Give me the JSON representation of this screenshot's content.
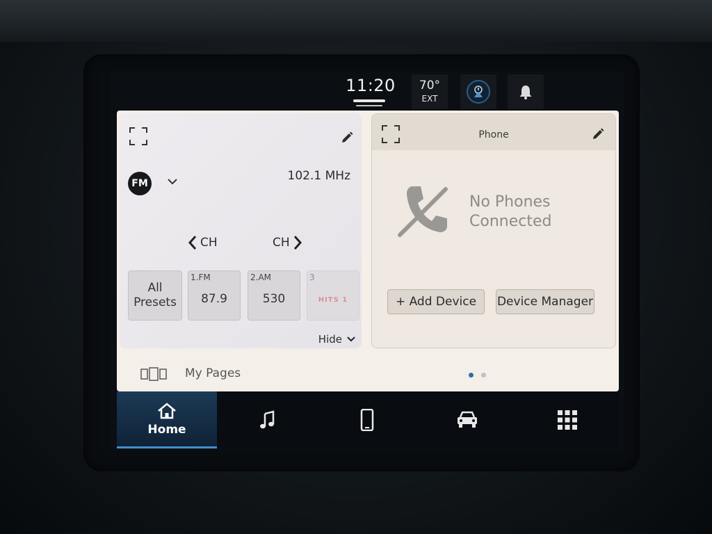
{
  "status_bar": {
    "time": "11:20",
    "temperature": "70°",
    "temperature_label": "EXT",
    "icons": [
      "driver-assist-icon",
      "bell-icon"
    ]
  },
  "radio_card": {
    "band": "FM",
    "frequency": "102.1 MHz",
    "ch_prev_label": "CH",
    "ch_next_label": "CH",
    "all_presets_label": "All Presets",
    "presets": [
      {
        "number": "1.FM",
        "value": "87.9"
      },
      {
        "number": "2.AM",
        "value": "530"
      },
      {
        "number": "3",
        "value": "HITS 1"
      }
    ],
    "hide_label": "Hide"
  },
  "phone_card": {
    "title": "Phone",
    "status_line1": "No Phones",
    "status_line2": "Connected",
    "add_device_label": "+ Add Device",
    "device_manager_label": "Device Manager"
  },
  "my_pages": {
    "label": "My Pages",
    "page_count": 2,
    "active_page": 1
  },
  "nav": {
    "items": [
      {
        "label": "Home",
        "icon": "home-icon",
        "active": true
      },
      {
        "label": "",
        "icon": "music-icon"
      },
      {
        "label": "",
        "icon": "phone-icon"
      },
      {
        "label": "",
        "icon": "vehicle-icon"
      },
      {
        "label": "",
        "icon": "apps-grid-icon"
      }
    ]
  },
  "colors": {
    "accent": "#3f8fd0",
    "display_bg": "#f4efe8",
    "nav_bg": "#090c10"
  }
}
